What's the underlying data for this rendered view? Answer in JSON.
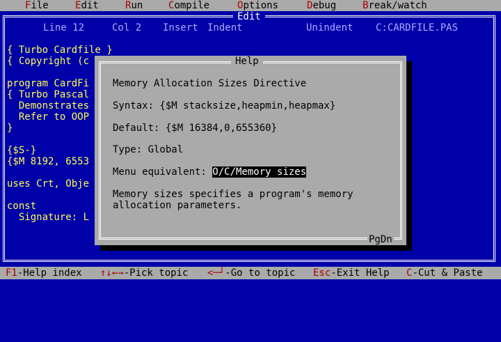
{
  "menu": {
    "items": [
      {
        "hot": "F",
        "rest": "ile"
      },
      {
        "hot": "E",
        "rest": "dit"
      },
      {
        "hot": "R",
        "rest": "un"
      },
      {
        "hot": "C",
        "rest": "ompile"
      },
      {
        "hot": "O",
        "rest": "ptions"
      },
      {
        "hot": "D",
        "rest": "ebug"
      },
      {
        "hot": "B",
        "rest": "reak/watch"
      }
    ]
  },
  "editor": {
    "title": "Edit",
    "line": "Line 12",
    "col": "Col 2",
    "insert": "Insert",
    "indent": "Indent",
    "unindent": "Unindent",
    "filename": "C:CARDFILE.PAS",
    "code": [
      "{ Turbo Cardfile }",
      "{ Copyright (c",
      "",
      "program CardFi",
      "{ Turbo Pascal",
      "  Demonstrates",
      "  Refer to OOP",
      "}",
      "",
      "{$S-}",
      "{$M 8192, 6553",
      "",
      "uses Crt, Obje",
      "",
      "const",
      "  Signature: L"
    ]
  },
  "help": {
    "title": "Help",
    "heading": "Memory Allocation Sizes Directive",
    "syntax": "Syntax: {$M stacksize,heapmin,heapmax}",
    "default": "Default: {$M 16384,0,655360}",
    "type": "Type: Global",
    "menu_label": "Menu equivalent: ",
    "menu_link": "O/C/Memory sizes",
    "desc_line1": "Memory sizes specifies a program's memory",
    "desc_line2": "allocation parameters.",
    "pgdn": "PgDn"
  },
  "hints": [
    {
      "key": "F1",
      "label": "-Help index"
    },
    {
      "key": "↑↓←→",
      "label": "-Pick topic"
    },
    {
      "key": "<─┘",
      "label": "-Go to topic"
    },
    {
      "key": "Esc",
      "label": "-Exit Help"
    },
    {
      "key": "C",
      "label": "-Cut & Paste"
    }
  ]
}
